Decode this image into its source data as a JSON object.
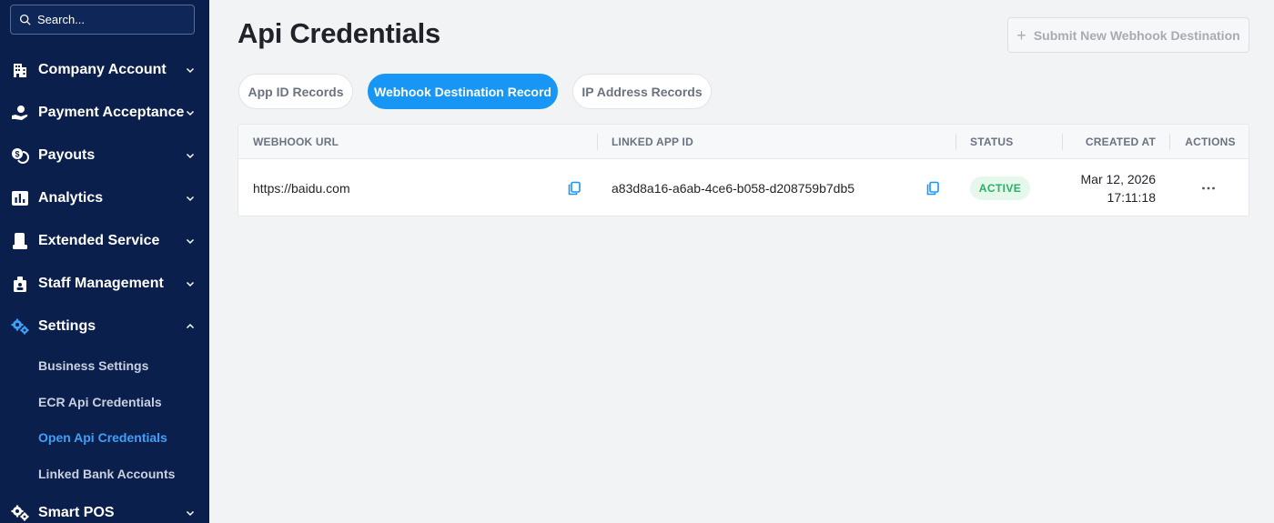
{
  "sidebar": {
    "search_placeholder": "Search...",
    "items": [
      {
        "label": "Company Account",
        "icon": "building-icon"
      },
      {
        "label": "Payment Acceptance",
        "icon": "hand-payment-icon"
      },
      {
        "label": "Payouts",
        "icon": "coins-icon"
      },
      {
        "label": "Analytics",
        "icon": "bar-chart-icon"
      },
      {
        "label": "Extended Service",
        "icon": "device-icon"
      },
      {
        "label": "Staff Management",
        "icon": "staff-icon"
      },
      {
        "label": "Settings",
        "icon": "gears-icon"
      },
      {
        "label": "Smart POS",
        "icon": "gears-icon"
      }
    ],
    "settings_sub": [
      {
        "label": "Business Settings"
      },
      {
        "label": "ECR Api Credentials"
      },
      {
        "label": "Open Api Credentials",
        "active": true
      },
      {
        "label": "Linked Bank Accounts"
      }
    ]
  },
  "main": {
    "title": "Api Credentials",
    "submit_label": "Submit New Webhook Destination",
    "tabs": [
      {
        "label": "App ID Records"
      },
      {
        "label": "Webhook Destination Record",
        "active": true
      },
      {
        "label": "IP Address Records"
      }
    ],
    "table": {
      "columns": [
        "WEBHOOK URL",
        "LINKED APP ID",
        "STATUS",
        "CREATED AT",
        "ACTIONS"
      ],
      "rows": [
        {
          "webhook_url": "https://baidu.com",
          "linked_app_id": "a83d8a16-a6ab-4ce6-b058-d208759b7db5",
          "status": "ACTIVE",
          "created_date": "Mar 12, 2026",
          "created_time": "17:11:18"
        }
      ]
    }
  },
  "colors": {
    "sidebar_bg": "#0b1f4d",
    "accent": "#1796f5",
    "active_link": "#3ea0f7",
    "status_active": "#22b365"
  }
}
